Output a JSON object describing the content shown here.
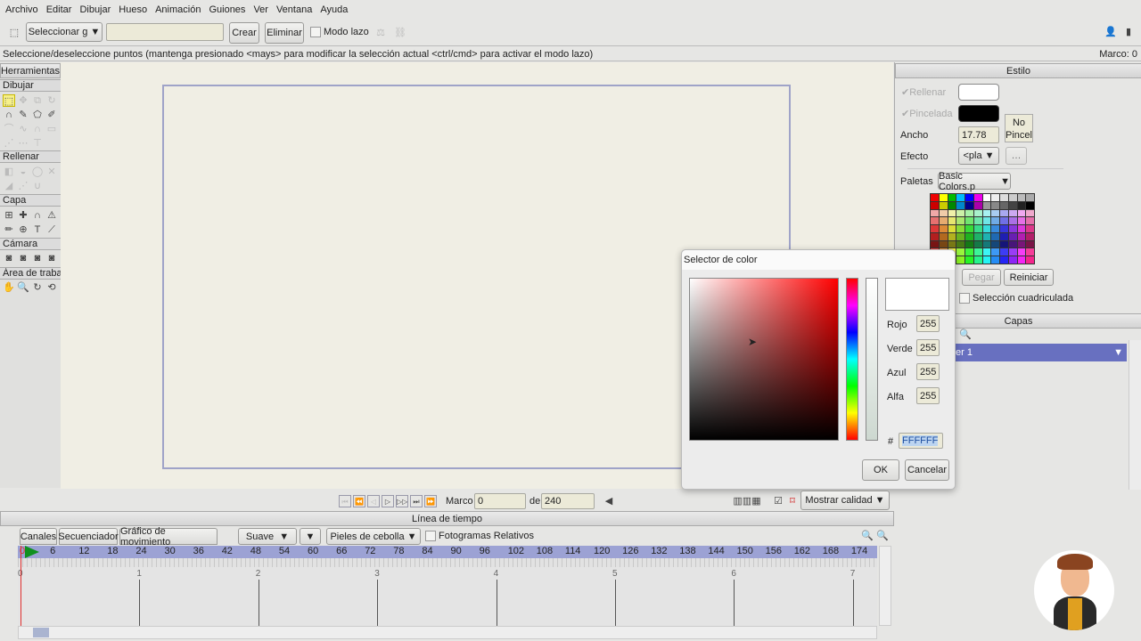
{
  "menu": [
    "Archivo",
    "Editar",
    "Dibujar",
    "Hueso",
    "Animación",
    "Guiones",
    "Ver",
    "Ventana",
    "Ayuda"
  ],
  "toolbar": {
    "select_mode": "Seleccionar g",
    "name_value": "",
    "create": "Crear",
    "delete": "Eliminar",
    "lasso": "Modo lazo"
  },
  "status": {
    "message": "Seleccione/deseleccione puntos (mantenga presionado <mays> para modificar la selección actual <ctrl/cmd> para activar el modo lazo)",
    "frame": "Marco: 0"
  },
  "tools": {
    "title": "Herramientas",
    "sections": [
      "Dibujar",
      "Rellenar",
      "Capa",
      "Cámara",
      "Área de trabajo"
    ]
  },
  "style": {
    "title": "Estilo",
    "fill": "Rellenar",
    "stroke": "Pincelada",
    "width_label": "Ancho",
    "width_value": "17.78",
    "no_brush": "No Pincel",
    "effect_label": "Efecto",
    "effect_value": "<pla",
    "palettes_label": "Paletas",
    "palette_value": "Basic Colors.p",
    "paste": "Pegar",
    "reset": "Reiniciar",
    "grid_select": "Selección cuadriculada",
    "fill_color": "#ffffff",
    "stroke_color": "#000000"
  },
  "layers": {
    "title": "Capas",
    "layer_name": "er 1"
  },
  "color_dialog": {
    "title": "Selector de color",
    "red_label": "Rojo",
    "red": "255",
    "green_label": "Verde",
    "green": "255",
    "blue_label": "Azul",
    "blue": "255",
    "alpha_label": "Alfa",
    "alpha": "255",
    "hash": "#",
    "hex": "FFFFFF",
    "ok": "OK",
    "cancel": "Cancelar"
  },
  "playback": {
    "frame_label": "Marco",
    "frame_value": "0",
    "of_label": "de",
    "end_value": "240",
    "quality": "Mostrar calidad"
  },
  "timeline": {
    "title": "Línea de tiempo",
    "tabs": [
      "Canales",
      "Secuenciador",
      "Gráfico de movimiento"
    ],
    "interp": "Suave",
    "onion": "Pieles de cebolla",
    "relative": "Fotogramas Relativos",
    "frame_ticks": [
      "0",
      "6",
      "12",
      "18",
      "24",
      "30",
      "36",
      "42",
      "48",
      "54",
      "60",
      "66",
      "72",
      "78",
      "84",
      "90",
      "96",
      "102",
      "108",
      "114",
      "120",
      "126",
      "132",
      "138",
      "144",
      "150",
      "156",
      "162",
      "168",
      "174"
    ],
    "second_ticks": [
      "0",
      "1",
      "2",
      "3",
      "4",
      "5",
      "6",
      "7"
    ]
  }
}
